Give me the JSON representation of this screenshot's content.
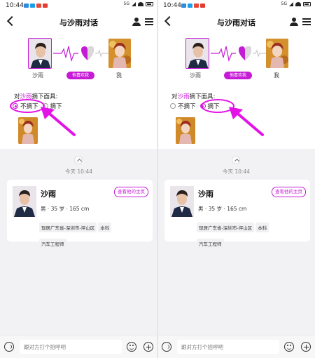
{
  "screens": [
    {
      "status": {
        "time": "10:44",
        "network": "5G"
      },
      "nav": {
        "title": "与沙雨对话"
      },
      "match": {
        "left_name": "沙雨",
        "right_name": "我",
        "badge": "他喜欢我"
      },
      "question": {
        "prefix": "对",
        "name": "沙雨",
        "suffix": "摘下面具:"
      },
      "radio": {
        "options": [
          "不摘下",
          "摘下"
        ],
        "selected": "不摘下"
      },
      "timestamp": "今天 10:44",
      "card": {
        "name": "沙雨",
        "home_button": "查看他的主页",
        "info": "男 · 35 岁 · 165 cm",
        "tags": [
          "现居广东省-深圳市-坪山区",
          "本科",
          "汽车工程师"
        ]
      },
      "input": {
        "placeholder": "跟对方打个招呼吧"
      }
    },
    {
      "status": {
        "time": "10:44",
        "network": "5G"
      },
      "nav": {
        "title": "与沙雨对话"
      },
      "match": {
        "left_name": "沙雨",
        "right_name": "我",
        "badge": "他喜欢我"
      },
      "question": {
        "prefix": "对",
        "name": "沙雨",
        "suffix": "摘下面具:"
      },
      "radio": {
        "options": [
          "不摘下",
          "摘下"
        ],
        "selected": "摘下"
      },
      "timestamp": "今天 10:44",
      "card": {
        "name": "沙雨",
        "home_button": "查看他的主页",
        "info": "男 · 35 岁 · 165 cm",
        "tags": [
          "现居广东省-深圳市-坪山区",
          "本科",
          "汽车工程师"
        ]
      },
      "input": {
        "placeholder": "跟对方打个招呼吧"
      }
    }
  ],
  "colors": {
    "accent": "#c61bd6",
    "annotation": "#e313e8",
    "background": "#f2f2f4"
  },
  "icons": [
    "back-icon",
    "user-icon",
    "menu-icon",
    "heart-icon",
    "voice-icon",
    "emoji-icon",
    "plus-icon",
    "chevron-up-icon"
  ]
}
